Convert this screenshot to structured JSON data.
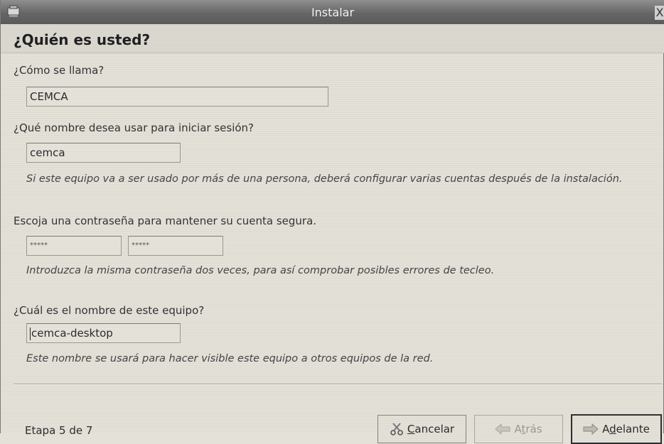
{
  "window": {
    "title": "Instalar",
    "close_glyph": "X"
  },
  "header": {
    "title": "¿Quién es usted?"
  },
  "fields": {
    "fullname": {
      "label": "¿Cómo se llama?",
      "value": "CEMCA"
    },
    "username": {
      "label": "¿Qué nombre desea usar para iniciar sesión?",
      "value": "cemca",
      "hint": "Si este equipo va a ser usado por más de una persona, deberá configurar varias cuentas después de la instalación."
    },
    "password": {
      "label": "Escoja una contraseña para mantener su cuenta segura.",
      "value": "*****",
      "confirm_value": "*****",
      "hint": "Introduzca la misma contraseña dos veces, para así comprobar posibles errores de tecleo."
    },
    "hostname": {
      "label": "¿Cuál es el nombre de este equipo?",
      "value": "cemca-desktop",
      "hint": "Este nombre se usará para hacer visible este equipo a otros equipos de la red."
    }
  },
  "footer": {
    "step": "Etapa 5 de 7",
    "cancel": {
      "mnemonic": "C",
      "rest": "ancelar",
      "icon": "scissors-icon"
    },
    "back": {
      "label_pre": "A",
      "mnemonic": "t",
      "rest": "rás",
      "icon": "arrow-left-icon",
      "enabled": false
    },
    "forward": {
      "label_pre": "A",
      "mnemonic": "d",
      "rest": "elante",
      "icon": "arrow-right-icon"
    }
  }
}
